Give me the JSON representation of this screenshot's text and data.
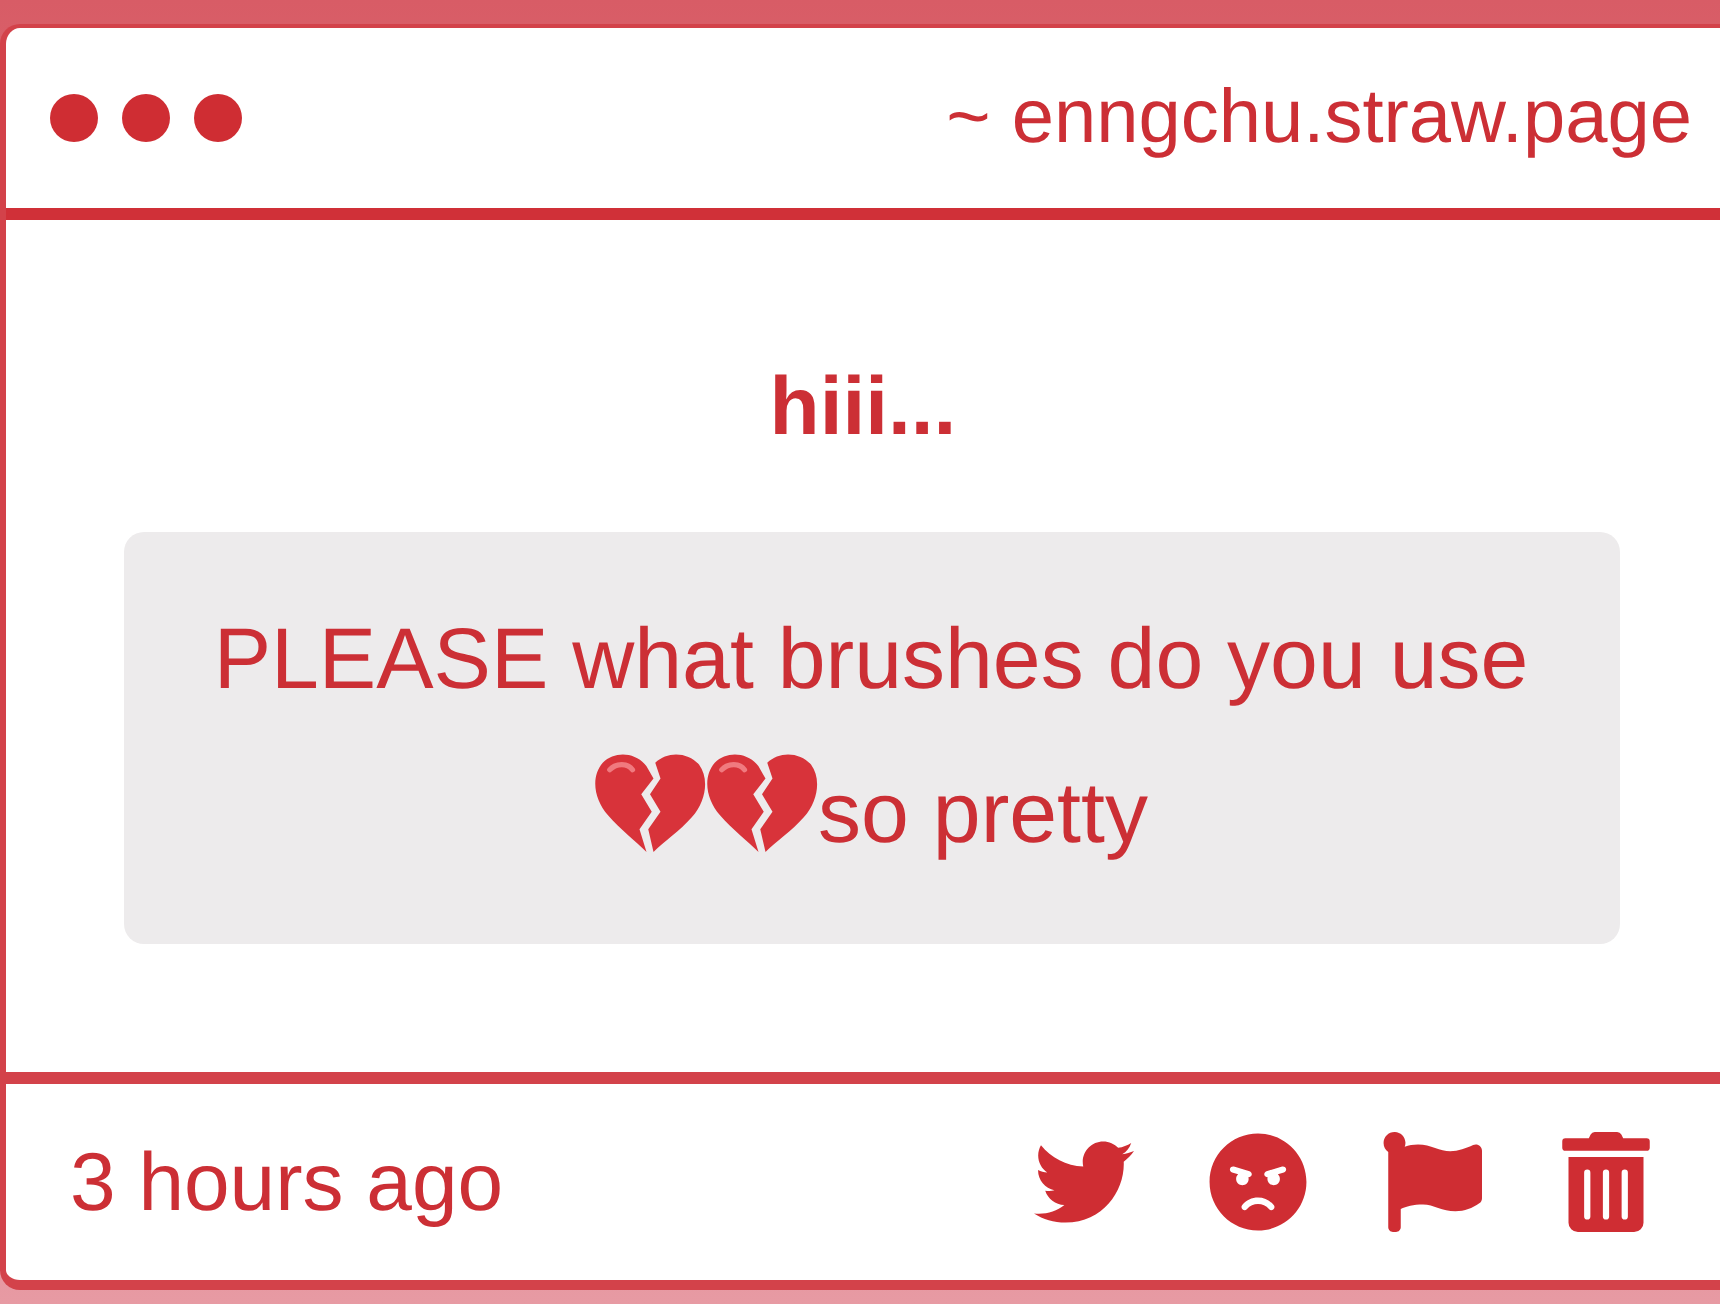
{
  "window": {
    "url": "~ enngchu.straw.page"
  },
  "post": {
    "title": "hiii...",
    "message": [
      {
        "kind": "text",
        "text": "PLEASE what brushes do you use"
      },
      {
        "kind": "broken-heart"
      },
      {
        "kind": "broken-heart"
      },
      {
        "kind": "text",
        "text": "so pretty"
      }
    ]
  },
  "footer": {
    "time": "3 hours ago",
    "actions": [
      {
        "kind": "bird"
      },
      {
        "kind": "angry-face"
      },
      {
        "kind": "flag"
      },
      {
        "kind": "trash"
      }
    ]
  }
}
